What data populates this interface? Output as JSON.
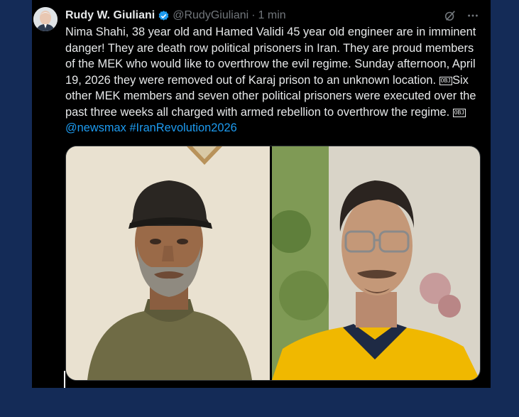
{
  "tweet": {
    "author_name": "Rudy W. Giuliani",
    "handle": "@RudyGiuliani",
    "separator": "·",
    "time": "1 min",
    "text_part1": "Nima Shahi, 38 year old and Hamed Validi 45 year old engineer are in imminent danger! They are death row political prisoners in Iran. They are proud members of the MEK who would like to overthrow the evil regime. Sunday afternoon, April 19, 2026 they were removed out of Karaj prison to an unknown location. ",
    "obj_glyph": "OBJ",
    "text_part2": "Six other MEK members and seven other political prisoners were executed over the past three weeks all charged with armed rebellion to overthrow the regime. ",
    "mention": "@newsmax",
    "hashtag": "#IranRevolution2026"
  },
  "icons": {
    "verified": "verified-badge-icon",
    "grok": "grok-icon",
    "more": "more-icon"
  },
  "colors": {
    "page_background": "#142b57",
    "card_background": "#000000",
    "primary_text": "#e7e9ea",
    "secondary_text": "#71767b",
    "link": "#1d9bf0",
    "verified": "#1d9bf0"
  }
}
